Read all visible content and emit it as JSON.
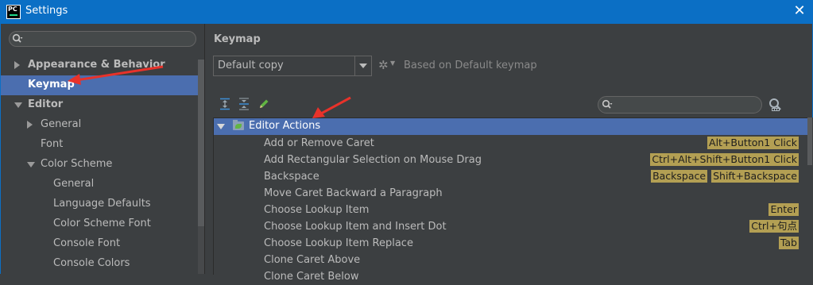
{
  "window": {
    "title": "Settings",
    "logo_text": "PC"
  },
  "sidebar": {
    "search_value": "",
    "items": [
      {
        "label": "Appearance & Behavior",
        "level": 0,
        "expander": "collapsed",
        "bold": true,
        "selected": false
      },
      {
        "label": "Keymap",
        "level": 0,
        "expander": "none",
        "bold": true,
        "selected": true
      },
      {
        "label": "Editor",
        "level": 0,
        "expander": "expanded",
        "bold": true,
        "selected": false
      },
      {
        "label": "General",
        "level": 1,
        "expander": "collapsed",
        "bold": false,
        "selected": false
      },
      {
        "label": "Font",
        "level": 1,
        "expander": "none",
        "bold": false,
        "selected": false
      },
      {
        "label": "Color Scheme",
        "level": 1,
        "expander": "expanded",
        "bold": false,
        "selected": false
      },
      {
        "label": "General",
        "level": 2,
        "expander": "none",
        "bold": false,
        "selected": false
      },
      {
        "label": "Language Defaults",
        "level": 2,
        "expander": "none",
        "bold": false,
        "selected": false
      },
      {
        "label": "Color Scheme Font",
        "level": 2,
        "expander": "none",
        "bold": false,
        "selected": false
      },
      {
        "label": "Console Font",
        "level": 2,
        "expander": "none",
        "bold": false,
        "selected": false
      },
      {
        "label": "Console Colors",
        "level": 2,
        "expander": "none",
        "bold": false,
        "selected": false
      }
    ]
  },
  "keymap": {
    "title": "Keymap",
    "scheme": "Default copy",
    "based_on": "Based on Default keymap",
    "toolbar_icons": [
      "expand-all-icon",
      "collapse-all-icon",
      "edit-shortcut-icon"
    ],
    "filter_value": "",
    "group": {
      "label": "Editor Actions",
      "expanded": true
    },
    "actions": [
      {
        "name": "Add or Remove Caret",
        "shortcuts": [
          "Alt+Button1 Click"
        ]
      },
      {
        "name": "Add Rectangular Selection on Mouse Drag",
        "shortcuts": [
          "Ctrl+Alt+Shift+Button1 Click"
        ]
      },
      {
        "name": "Backspace",
        "shortcuts": [
          "Backspace",
          "Shift+Backspace"
        ]
      },
      {
        "name": "Move Caret Backward a Paragraph",
        "shortcuts": []
      },
      {
        "name": "Choose Lookup Item",
        "shortcuts": [
          "Enter"
        ]
      },
      {
        "name": "Choose Lookup Item and Insert Dot",
        "shortcuts": [
          "Ctrl+句点"
        ]
      },
      {
        "name": "Choose Lookup Item Replace",
        "shortcuts": [
          "Tab"
        ]
      },
      {
        "name": "Clone Caret Above",
        "shortcuts": []
      },
      {
        "name": "Clone Caret Below",
        "shortcuts": []
      }
    ]
  },
  "colors": {
    "titlebar": "#0b6fc5",
    "selection": "#4b6eaf",
    "shortcut_badge": "#b39f53",
    "annotation_arrow": "#e8322a",
    "panel": "#3c3f41"
  }
}
